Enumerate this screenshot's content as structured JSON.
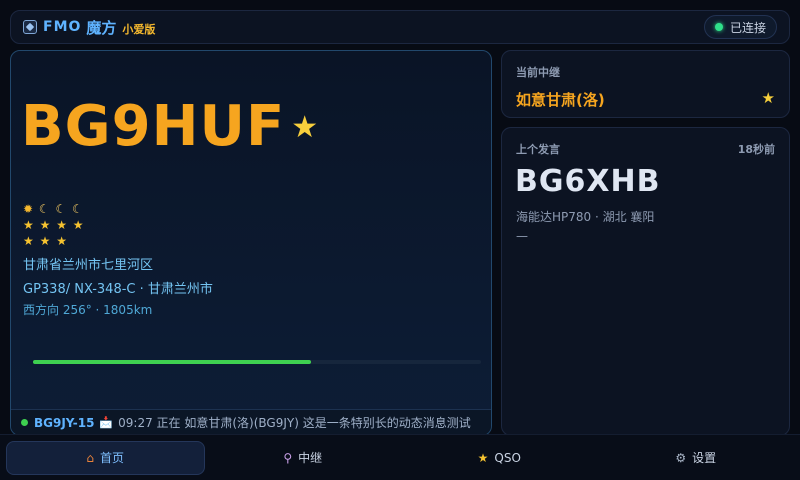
{
  "header": {
    "brand": "FMO",
    "brand_cn": "魔方",
    "edition": "小爱版",
    "status": "已连接",
    "accent_color": "#5fb3ff",
    "status_color": "#2fe08a"
  },
  "main": {
    "callsign": "BG9HUF",
    "star": "★",
    "levels": [
      "🌞🌙🌙🌙",
      "⭐⭐⭐⭐",
      "⭐⭐⭐"
    ],
    "level_row1": "✹ ☾ ☾ ☾",
    "level_row2": "★ ★ ★ ★",
    "level_row3": "★ ★ ★",
    "location": "甘肃省兰州市七里河区",
    "grid_info": "GP338/ NX-348-C · 甘肃兰州市",
    "bearing": "西方向 256° · 1805km",
    "progress": 0.62,
    "ticker": {
      "callsign": "BG9JY-15",
      "mail_icon": "📩",
      "message": "09:27 正在 如意甘肃(洛)(BG9JY) 这是一条特别长的动态消息测试"
    }
  },
  "repeater": {
    "label": "当前中继",
    "name": "如意甘肃(洛)",
    "star": "★"
  },
  "last_speaker": {
    "label": "上个发言",
    "time": "18秒前",
    "callsign": "BG6XHB",
    "device": "海能达HP780 · 湖北 襄阳",
    "extra": "—"
  },
  "nav": {
    "items": [
      {
        "label": "首页",
        "icon": "home-icon",
        "active": true
      },
      {
        "label": "中继",
        "icon": "repeater-icon",
        "active": false
      },
      {
        "label": "QSO",
        "icon": "star-icon",
        "active": false
      },
      {
        "label": "设置",
        "icon": "gear-icon",
        "active": false
      }
    ]
  }
}
